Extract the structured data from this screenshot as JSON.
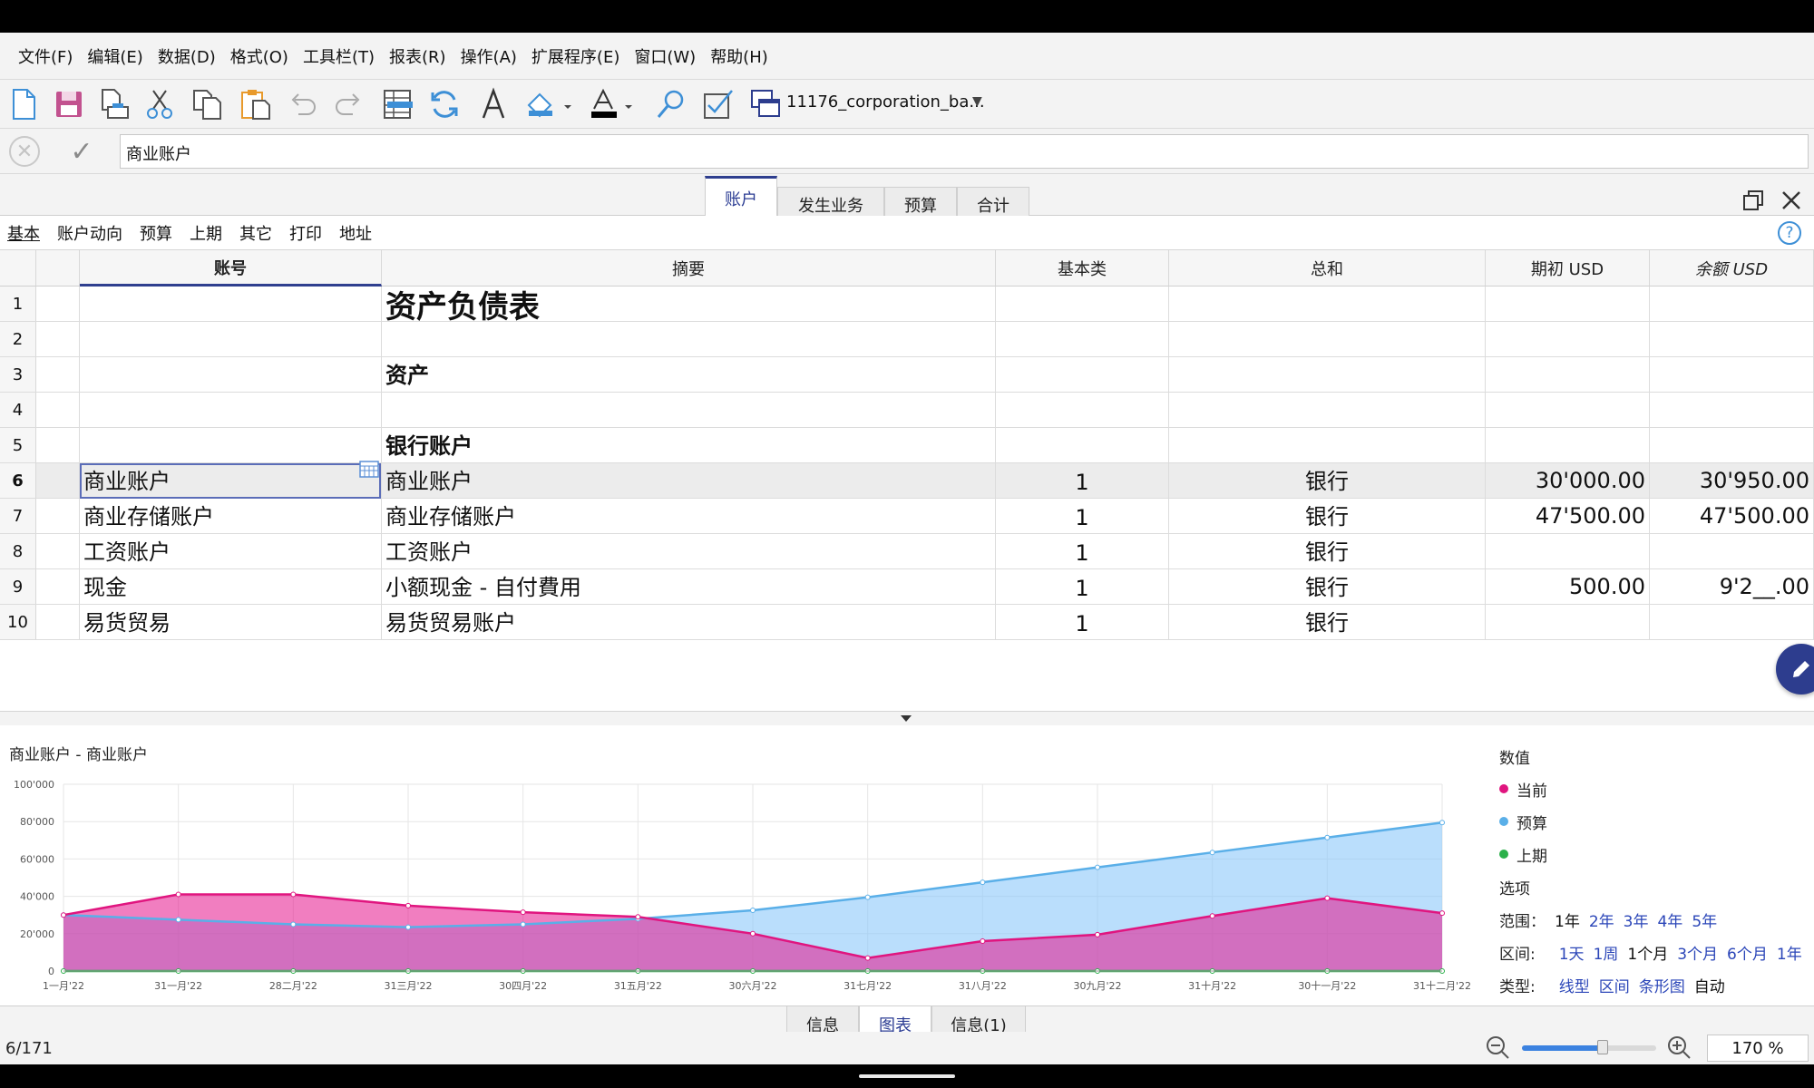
{
  "menu": [
    "文件(F)",
    "编辑(E)",
    "数据(D)",
    "格式(O)",
    "工具栏(T)",
    "报表(R)",
    "操作(A)",
    "扩展程序(E)",
    "窗口(W)",
    "帮助(H)"
  ],
  "toolbar": {
    "file_name": "11176_corporation_ba..."
  },
  "edit_bar": {
    "value": "商业账户"
  },
  "table_tabs": [
    "账户",
    "发生业务",
    "预算",
    "合计"
  ],
  "views": [
    "基本",
    "账户动向",
    "预算",
    "上期",
    "其它",
    "打印",
    "地址"
  ],
  "columns": [
    "账号",
    "摘要",
    "基本类",
    "总和",
    "期初 USD",
    "余额 USD"
  ],
  "rows": [
    {
      "n": "1",
      "account": "",
      "desc": "资产负债表",
      "type": "",
      "group": "",
      "opening": "",
      "balance": ""
    },
    {
      "n": "2",
      "account": "",
      "desc": "",
      "type": "",
      "group": "",
      "opening": "",
      "balance": ""
    },
    {
      "n": "3",
      "account": "",
      "desc": "资产",
      "type": "",
      "group": "",
      "opening": "",
      "balance": ""
    },
    {
      "n": "4",
      "account": "",
      "desc": "",
      "type": "",
      "group": "",
      "opening": "",
      "balance": ""
    },
    {
      "n": "5",
      "account": "",
      "desc": "银行账户",
      "type": "",
      "group": "",
      "opening": "",
      "balance": ""
    },
    {
      "n": "6",
      "account": "商业账户",
      "desc": "商业账户",
      "type": "1",
      "group": "银行",
      "opening": "30'000.00",
      "balance": "30'950.00"
    },
    {
      "n": "7",
      "account": "商业存储账户",
      "desc": "商业存储账户",
      "type": "1",
      "group": "银行",
      "opening": "47'500.00",
      "balance": "47'500.00"
    },
    {
      "n": "8",
      "account": "工资账户",
      "desc": "工资账户",
      "type": "1",
      "group": "银行",
      "opening": "",
      "balance": ""
    },
    {
      "n": "9",
      "account": "现金",
      "desc": "小额现金 - 自付費用",
      "type": "1",
      "group": "银行",
      "opening": "500.00",
      "balance": "9'2__.00"
    },
    {
      "n": "10",
      "account": "易货贸易",
      "desc": "易货贸易账户",
      "type": "1",
      "group": "银行",
      "opening": "",
      "balance": ""
    }
  ],
  "chart_panel": {
    "title": "商业账户 - 商业账户",
    "legend_title": "数值",
    "options_title": "选项",
    "range_label": "范围：",
    "range_options": [
      "1年",
      "2年",
      "3年",
      "4年",
      "5年"
    ],
    "interval_label": "区间:",
    "interval_options": [
      "1天",
      "1周",
      "1个月",
      "3个月",
      "6个月",
      "1年"
    ],
    "type_label": "类型:",
    "type_options": [
      "线型",
      "区间",
      "条形图",
      "自动"
    ]
  },
  "chart_data": {
    "type": "area",
    "categories": [
      "1一月'22",
      "31一月'22",
      "28二月'22",
      "31三月'22",
      "30四月'22",
      "31五月'22",
      "30六月'22",
      "31七月'22",
      "31八月'22",
      "30九月'22",
      "31十月'22",
      "30十一月'22",
      "31十二月'22"
    ],
    "ylim": [
      0,
      100000
    ],
    "yticks": [
      "0",
      "20'000",
      "40'000",
      "60'000",
      "80'000",
      "100'000"
    ],
    "grid": true,
    "legend_position": "right",
    "series": [
      {
        "name": "当前",
        "color": "#e0157f",
        "values": [
          30000,
          41000,
          41000,
          35000,
          31500,
          29000,
          20000,
          7000,
          16000,
          19500,
          29500,
          39000,
          31000
        ]
      },
      {
        "name": "预算",
        "color": "#5aafe8",
        "values": [
          30000,
          27500,
          25000,
          23500,
          25000,
          28000,
          32500,
          39500,
          47500,
          55500,
          63500,
          71500,
          79500
        ]
      },
      {
        "name": "上期",
        "color": "#2bb04a",
        "values": [
          0,
          0,
          0,
          0,
          0,
          0,
          0,
          0,
          0,
          0,
          0,
          0,
          0
        ]
      }
    ]
  },
  "bottom_tabs": [
    "信息",
    "图表",
    "信息(1)"
  ],
  "status": {
    "position": "6/171",
    "zoom": "170 %",
    "zoom_level": 0.6
  }
}
